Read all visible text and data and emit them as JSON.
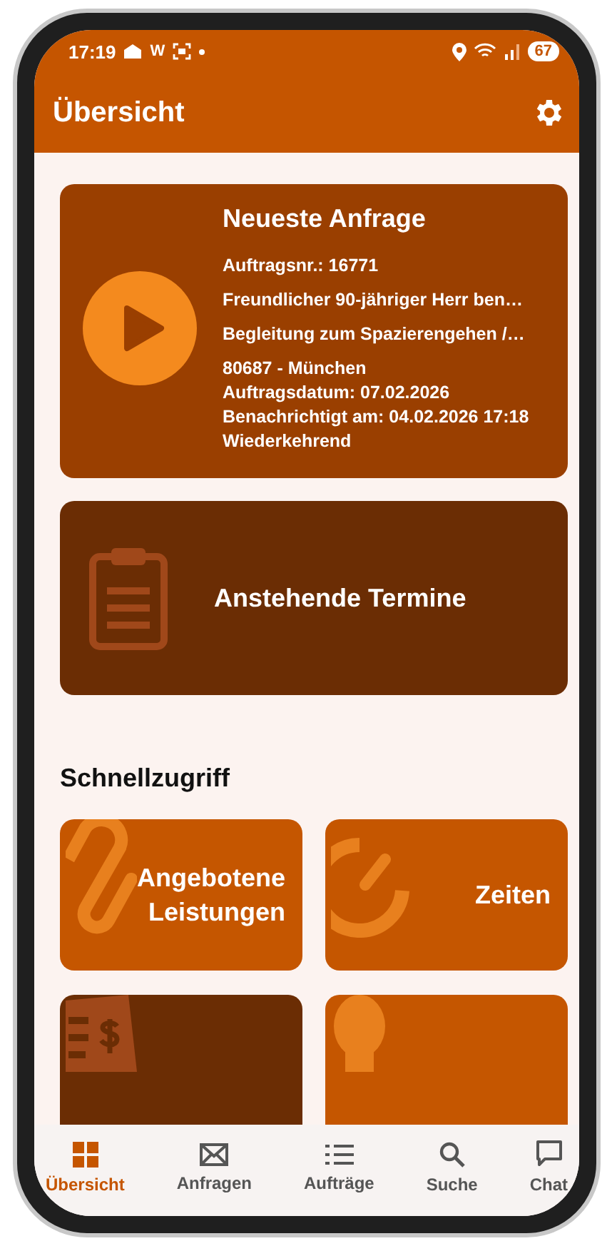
{
  "status_bar": {
    "time": "17:19",
    "notification_letter": "W",
    "battery": "67"
  },
  "app_bar": {
    "title": "Übersicht"
  },
  "latest_request": {
    "title": "Neueste Anfrage",
    "summary_lines": [
      "Auftragsnr.: 16771",
      "Freundlicher 90-jähriger Herr ben…",
      "Begleitung zum Spazierengehen /…"
    ],
    "detail_lines": [
      "80687 - München",
      "Auftragsdatum: 07.02.2026",
      "Benachrichtigt am: 04.02.2026 17:18",
      "Wiederkehrend"
    ]
  },
  "upcoming": {
    "label": "Anstehende Termine"
  },
  "quick_access": {
    "title": "Schnellzugriff",
    "tiles": [
      {
        "label": "Angebotene Leistungen",
        "color": "#c55600"
      },
      {
        "label": "Zeiten",
        "color": "#c55600"
      },
      {
        "color": "#6b2d04"
      },
      {
        "color": "#c55600"
      }
    ]
  },
  "bottom_nav": [
    {
      "label": "Übersicht",
      "selected": true
    },
    {
      "label": "Anfragen",
      "selected": false
    },
    {
      "label": "Aufträge",
      "selected": false
    },
    {
      "label": "Suche",
      "selected": false
    },
    {
      "label": "Chat",
      "selected": false
    }
  ]
}
